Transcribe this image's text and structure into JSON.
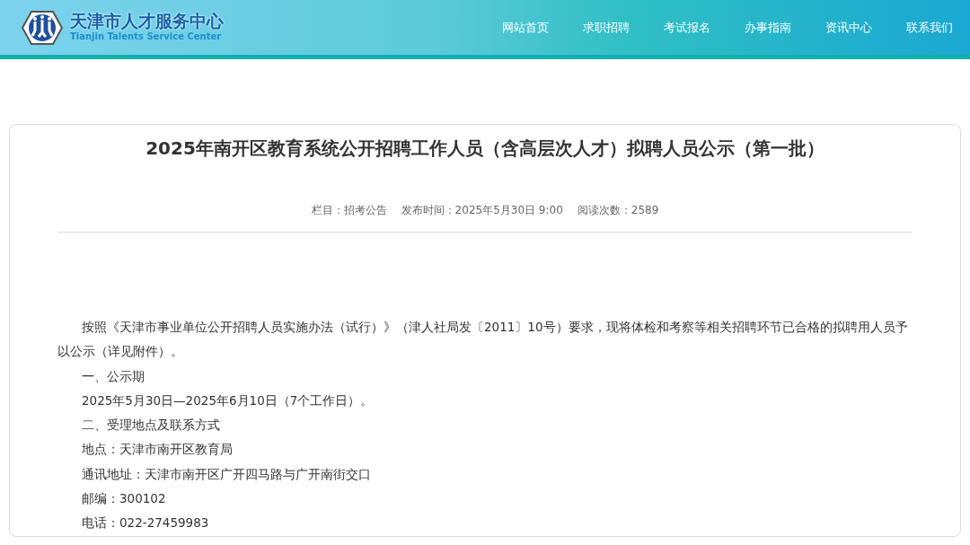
{
  "header": {
    "logo_title": "天津市人才服务中心",
    "logo_subtitle": "Tianjin Talents Service Center",
    "nav": [
      {
        "label": "网站首页"
      },
      {
        "label": "求职招聘"
      },
      {
        "label": "考试报名"
      },
      {
        "label": "办事指南"
      },
      {
        "label": "资讯中心"
      },
      {
        "label": "联系我们"
      }
    ]
  },
  "article": {
    "title": "2025年南开区教育系统公开招聘工作人员（含高层次人才）拟聘人员公示（第一批）",
    "meta": [
      "栏目：招考公告",
      "发布时间：2025年5月30日 9:00",
      "阅读次数：2589"
    ],
    "paragraphs": [
      "按照《天津市事业单位公开招聘人员实施办法（试行）》（津人社局发〔2011〕10号）要求，现将体检和考察等相关招聘环节已合格的拟聘用人员予以公示（详见附件）。",
      "一、公示期",
      "2025年5月30日—2025年6月10日（7个工作日）。",
      "二、受理地点及联系方式",
      "地点：天津市南开区教育局",
      "通讯地址：天津市南开区广开四马路与广开南街交口",
      "邮编：300102",
      "电话：022-27459983"
    ]
  }
}
